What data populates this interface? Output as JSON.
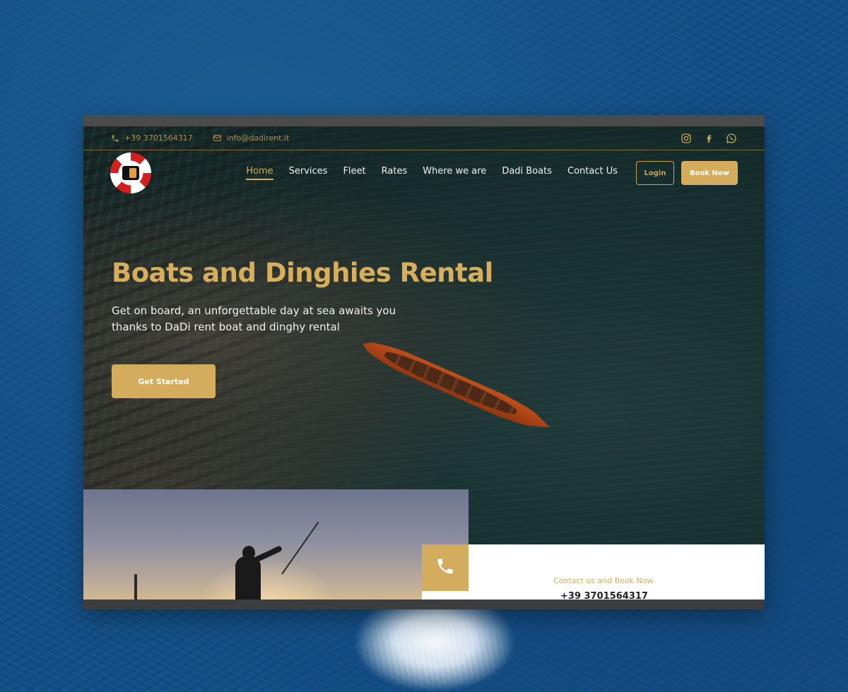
{
  "colors": {
    "accent": "#d3ac5e",
    "sea": "#134f86",
    "hero_dark": "#162c2b",
    "text_light": "#f1f1f1"
  },
  "topbar": {
    "phone": "+39 3701564317",
    "email": "info@dadirent.it",
    "phone_icon": "phone-icon",
    "email_icon": "mail-icon",
    "social": [
      "instagram-icon",
      "facebook-icon",
      "whatsapp-icon"
    ]
  },
  "nav": {
    "items": [
      {
        "label": "Home",
        "active": true
      },
      {
        "label": "Services",
        "active": false
      },
      {
        "label": "Fleet",
        "active": false
      },
      {
        "label": "Rates",
        "active": false
      },
      {
        "label": "Where we are",
        "active": false
      },
      {
        "label": "Dadi Boats",
        "active": false
      },
      {
        "label": "Contact Us",
        "active": false
      }
    ],
    "login_label": "Login",
    "book_label": "Book Now"
  },
  "hero": {
    "title": "Boats and Dinghies Rental",
    "subtitle_line1": "Get on board, an unforgettable day at sea awaits you",
    "subtitle_line2": "thanks to DaDi rent boat and dinghy rental",
    "cta_label": "Get Started"
  },
  "contact": {
    "label": "Contact us and Book Now",
    "phone": "+39 3701564317",
    "icon": "phone-icon"
  }
}
